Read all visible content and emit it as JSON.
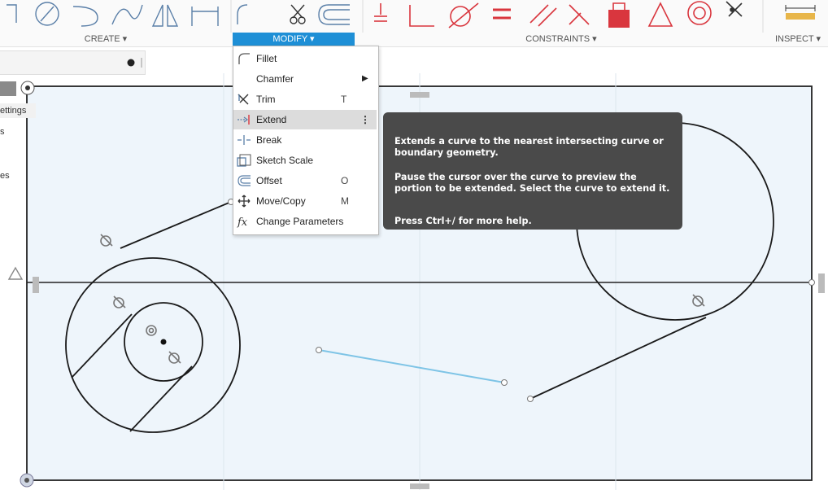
{
  "toolbar": {
    "groups": [
      {
        "label": "CREATE ▾"
      },
      {
        "label": "MODIFY ▾"
      },
      {
        "label": "CONSTRAINTS ▾"
      },
      {
        "label": "INSPECT ▾"
      }
    ]
  },
  "sidebar": {
    "settings_label": "ettings",
    "item_s": "s",
    "item_es": "es"
  },
  "modify_menu": {
    "items": [
      {
        "label": "Fillet",
        "shortcut": "",
        "icon": "fillet-icon"
      },
      {
        "label": "Chamfer",
        "shortcut": "",
        "icon": "chamfer-icon",
        "submenu": "▶"
      },
      {
        "label": "Trim",
        "shortcut": "T",
        "icon": "trim-icon"
      },
      {
        "label": "Extend",
        "shortcut": "",
        "icon": "extend-icon",
        "more": "⋮"
      },
      {
        "label": "Break",
        "shortcut": "",
        "icon": "break-icon"
      },
      {
        "label": "Sketch Scale",
        "shortcut": "",
        "icon": "sketch-scale-icon"
      },
      {
        "label": "Offset",
        "shortcut": "O",
        "icon": "offset-icon"
      },
      {
        "label": "Move/Copy",
        "shortcut": "M",
        "icon": "move-copy-icon"
      },
      {
        "label": "Change Parameters",
        "shortcut": "",
        "icon": "fx-icon"
      }
    ]
  },
  "tooltip": {
    "line1": "Extends a curve to the nearest intersecting curve or boundary geometry.",
    "line2": "Pause the cursor over the curve to preview the portion to be extended. Select the curve to extend it.",
    "line3": "Press Ctrl+/ for more help."
  },
  "colors": {
    "accent": "#1e8fd6",
    "constraint_red": "#d9363e",
    "canvas_bg": "#eef5fb",
    "sketch_line": "#1a1a1a",
    "selected_line": "#7ec4e6",
    "tooltip_bg": "#4a4a4a"
  }
}
